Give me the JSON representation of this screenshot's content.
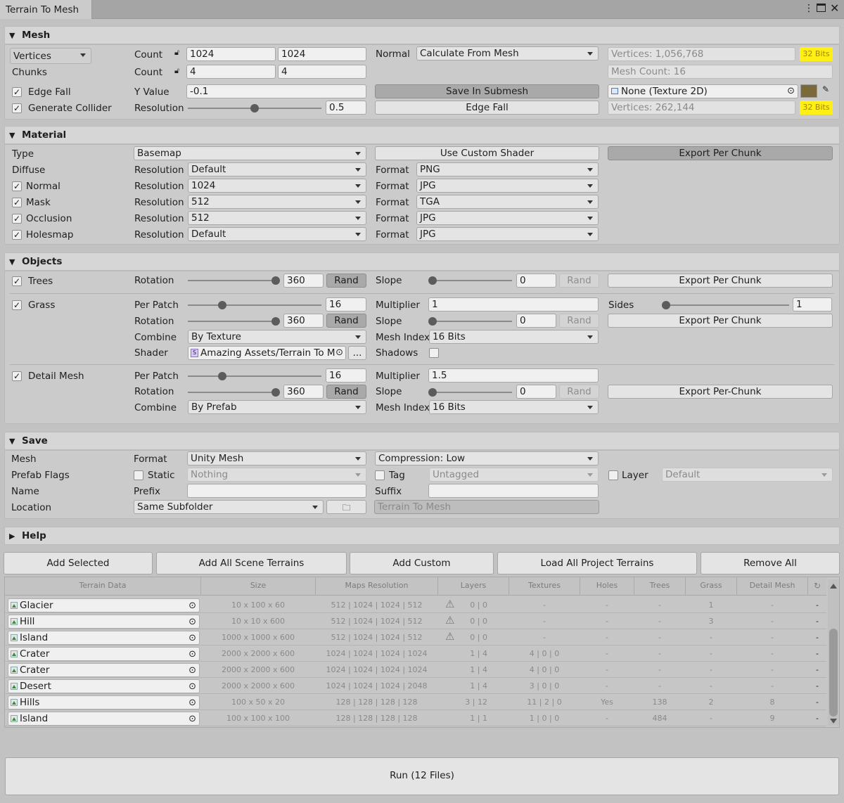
{
  "tab": {
    "title": "Terrain To Mesh"
  },
  "mesh": {
    "header": "Mesh",
    "vertices_dropdown": "Vertices",
    "chunks_label": "Chunks",
    "count_label": "Count",
    "vertex_count_x": "1024",
    "vertex_count_y": "1024",
    "chunk_count_x": "4",
    "chunk_count_y": "4",
    "edge_fall_label": "Edge Fall",
    "generate_collider_label": "Generate Collider",
    "y_value_label": "Y Value",
    "y_value": "-0.1",
    "resolution_label": "Resolution",
    "resolution_value": "0.5",
    "resolution_level": 0.5,
    "normal_label": "Normal",
    "normal_value": "Calculate From Mesh",
    "save_in_submesh": "Save In Submesh",
    "edge_fall_button": "Edge Fall",
    "vertices_info": "Vertices: 1,056,768",
    "bits_badge_1": "32 Bits",
    "mesh_count_info": "Mesh Count: 16",
    "texture_field": "None (Texture 2D)",
    "vertices_info_2": "Vertices: 262,144",
    "bits_badge_2": "32 Bits",
    "color_swatch": "#7a6a3a",
    "badge_color": "#ffef14"
  },
  "material": {
    "header": "Material",
    "type_label": "Type",
    "type_value": "Basemap",
    "use_custom_shader": "Use Custom Shader",
    "export_per_chunk": "Export Per Chunk",
    "resolution_label": "Resolution",
    "format_label": "Format",
    "rows": [
      {
        "label": "Diffuse",
        "resolution": "Default",
        "format": "PNG"
      },
      {
        "label": "Normal",
        "resolution": "1024",
        "format": "JPG"
      },
      {
        "label": "Mask",
        "resolution": "512",
        "format": "TGA"
      },
      {
        "label": "Occlusion",
        "resolution": "512",
        "format": "JPG"
      },
      {
        "label": "Holesmap",
        "resolution": "Default",
        "format": "JPG"
      }
    ]
  },
  "objects": {
    "header": "Objects",
    "trees": {
      "label": "Trees",
      "rotation_label": "Rotation",
      "rotation": "360",
      "rand": "Rand",
      "slope_label": "Slope",
      "slope": "0",
      "export": "Export Per Chunk"
    },
    "grass": {
      "label": "Grass",
      "per_patch_label": "Per Patch",
      "per_patch": "16",
      "multiplier_label": "Multiplier",
      "multiplier": "1",
      "sides_label": "Sides",
      "sides": "1",
      "rotation_label": "Rotation",
      "rotation": "360",
      "rand": "Rand",
      "slope_label": "Slope",
      "slope": "0",
      "export": "Export Per Chunk",
      "combine_label": "Combine",
      "combine": "By Texture",
      "mesh_index_label": "Mesh Index",
      "mesh_index": "16 Bits",
      "shader_label": "Shader",
      "shader": "Amazing Assets/Terrain To M",
      "shader_more": "...",
      "shadows_label": "Shadows"
    },
    "detail": {
      "label": "Detail Mesh",
      "per_patch_label": "Per Patch",
      "per_patch": "16",
      "multiplier_label": "Multiplier",
      "multiplier": "1.5",
      "rotation_label": "Rotation",
      "rotation": "360",
      "rand": "Rand",
      "slope_label": "Slope",
      "slope": "0",
      "export": "Export Per-Chunk",
      "combine_label": "Combine",
      "combine": "By Prefab",
      "mesh_index_label": "Mesh Index",
      "mesh_index": "16 Bits"
    }
  },
  "save": {
    "header": "Save",
    "mesh_label": "Mesh",
    "format_label": "Format",
    "format": "Unity Mesh",
    "compression": "Compression: Low",
    "prefab_flags_label": "Prefab Flags",
    "static_label": "Static",
    "static_value": "Nothing",
    "tag_label": "Tag",
    "tag_value": "Untagged",
    "layer_label": "Layer",
    "layer_value": "Default",
    "name_label": "Name",
    "prefix_label": "Prefix",
    "suffix_label": "Suffix",
    "location_label": "Location",
    "location": "Same Subfolder",
    "location_path": "Terrain To Mesh"
  },
  "help": {
    "header": "Help"
  },
  "actions": {
    "add_selected": "Add Selected",
    "add_all_scene": "Add All Scene Terrains",
    "add_custom": "Add Custom",
    "load_all_project": "Load All Project Terrains",
    "remove_all": "Remove All"
  },
  "table": {
    "headers": [
      "Terrain Data",
      "Size",
      "Maps Resolution",
      "Layers",
      "Textures",
      "Holes",
      "Trees",
      "Grass",
      "Detail Mesh"
    ],
    "rows": [
      {
        "name": "Glacier",
        "size": "10 x 100 x 60",
        "maps": "512 | 1024 | 1024 | 512",
        "warn": true,
        "layers": "0 | 0",
        "textures": "-",
        "holes": "-",
        "trees": "-",
        "grass": "1",
        "detail": "-",
        "x": "-"
      },
      {
        "name": "Hill",
        "size": "10 x 10 x 600",
        "maps": "512 | 1024 | 1024 | 512",
        "warn": true,
        "layers": "0 | 0",
        "textures": "-",
        "holes": "-",
        "trees": "-",
        "grass": "3",
        "detail": "-",
        "x": "-"
      },
      {
        "name": "Island",
        "size": "1000 x 1000 x 600",
        "maps": "512 | 1024 | 1024 | 512",
        "warn": true,
        "layers": "0 | 0",
        "textures": "-",
        "holes": "-",
        "trees": "-",
        "grass": "-",
        "detail": "-",
        "x": "-"
      },
      {
        "name": "Crater",
        "size": "2000 x 2000 x 600",
        "maps": "1024 | 1024 | 1024 | 1024",
        "warn": false,
        "layers": "1 | 4",
        "textures": "4 | 0 | 0",
        "holes": "-",
        "trees": "-",
        "grass": "-",
        "detail": "-",
        "x": "-"
      },
      {
        "name": "Crater",
        "size": "2000 x 2000 x 600",
        "maps": "1024 | 1024 | 1024 | 1024",
        "warn": false,
        "layers": "1 | 4",
        "textures": "4 | 0 | 0",
        "holes": "-",
        "trees": "-",
        "grass": "-",
        "detail": "-",
        "x": "-"
      },
      {
        "name": "Desert",
        "size": "2000 x 2000 x 600",
        "maps": "1024 | 1024 | 1024 | 2048",
        "warn": false,
        "layers": "1 | 4",
        "textures": "3 | 0 | 0",
        "holes": "-",
        "trees": "-",
        "grass": "-",
        "detail": "-",
        "x": "-"
      },
      {
        "name": "Hills",
        "size": "100 x 50 x 20",
        "maps": "128 | 128 | 128 | 128",
        "warn": false,
        "layers": "3 | 12",
        "textures": "11 | 2 | 0",
        "holes": "Yes",
        "trees": "138",
        "grass": "2",
        "detail": "8",
        "x": "-"
      },
      {
        "name": "Island",
        "size": "100 x 100 x 100",
        "maps": "128 | 128 | 128 | 128",
        "warn": false,
        "layers": "1 | 1",
        "textures": "1 | 0 | 0",
        "holes": "-",
        "trees": "484",
        "grass": "-",
        "detail": "9",
        "x": "-"
      }
    ]
  },
  "run": {
    "label": "Run (12 Files)"
  }
}
